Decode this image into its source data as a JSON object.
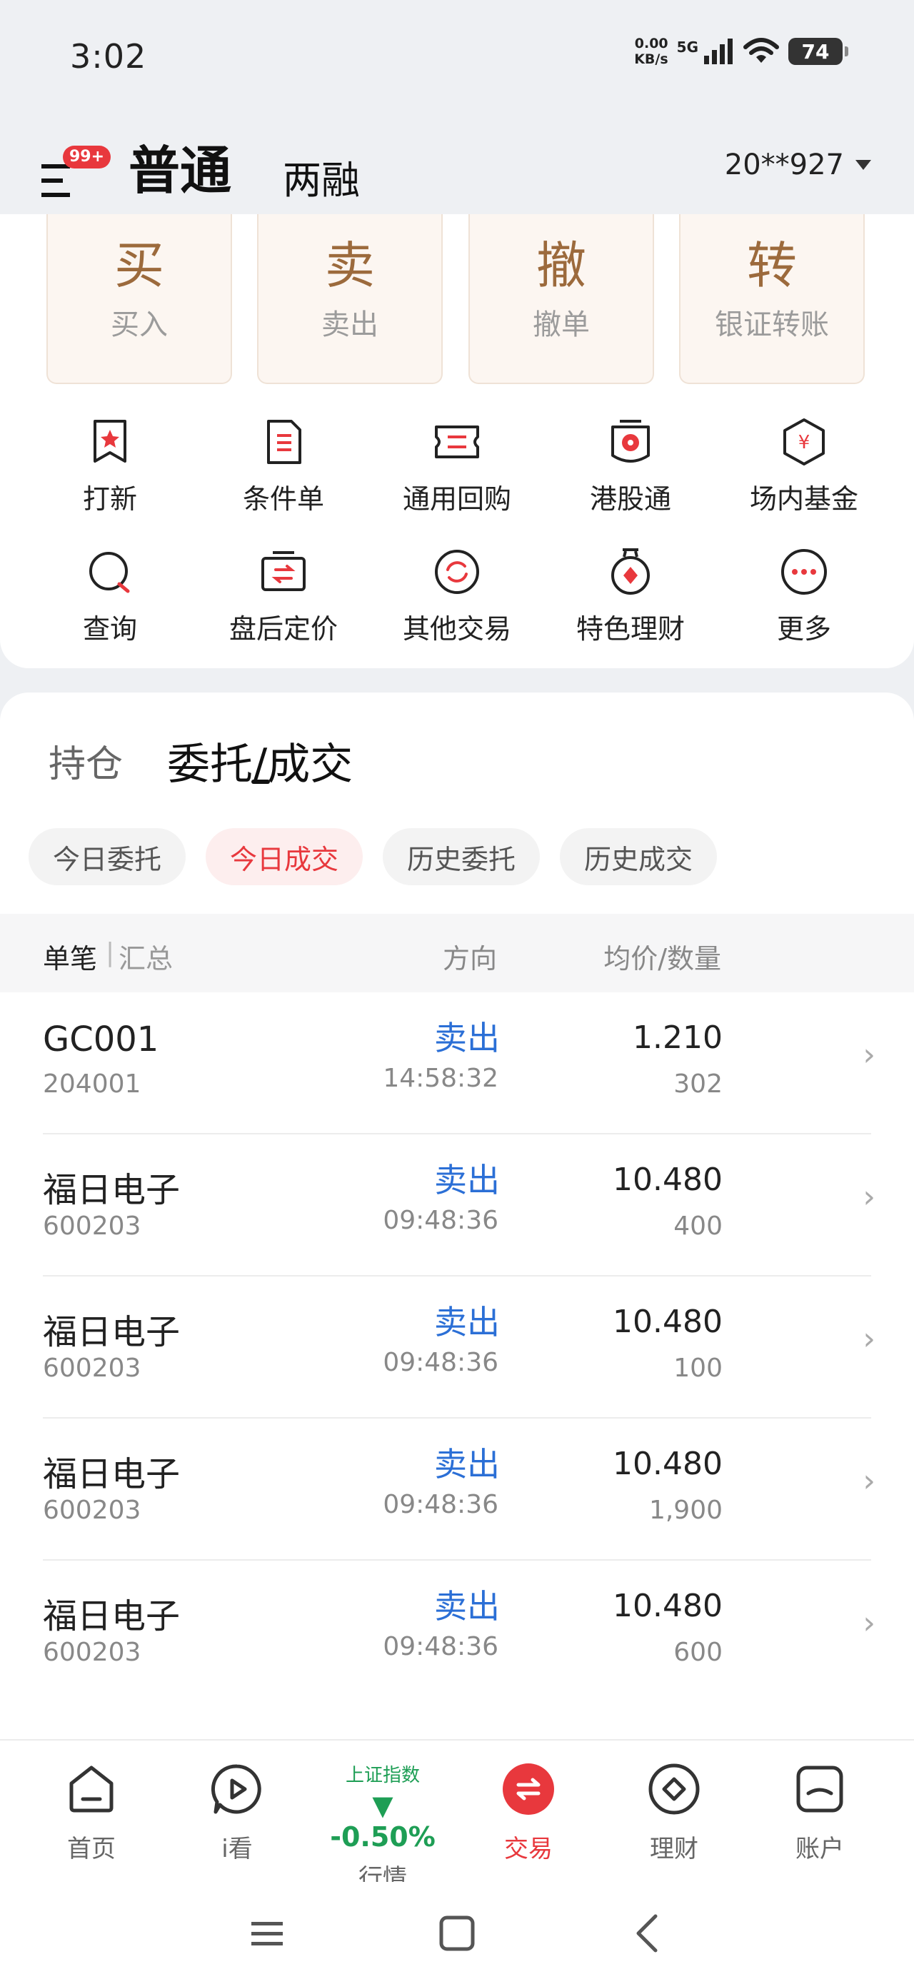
{
  "status_bar": {
    "time": "3:02",
    "net_speed_value": "0.00",
    "net_speed_unit": "KB/s",
    "network": "5G",
    "battery": "74"
  },
  "header": {
    "menu_badge": "99+",
    "tab_normal": "普通",
    "tab_margin": "两融",
    "account": "20**927"
  },
  "trade_buttons": [
    {
      "char": "买",
      "label": "买入"
    },
    {
      "char": "卖",
      "label": "卖出"
    },
    {
      "char": "撤",
      "label": "撤单"
    },
    {
      "char": "转",
      "label": "银证转账"
    }
  ],
  "functions": [
    {
      "label": "打新",
      "icon": "new-stock-icon"
    },
    {
      "label": "条件单",
      "icon": "conditional-order-icon"
    },
    {
      "label": "通用回购",
      "icon": "repo-icon"
    },
    {
      "label": "港股通",
      "icon": "hk-connect-icon"
    },
    {
      "label": "场内基金",
      "icon": "fund-icon"
    },
    {
      "label": "查询",
      "icon": "query-icon"
    },
    {
      "label": "盘后定价",
      "icon": "after-hours-icon"
    },
    {
      "label": "其他交易",
      "icon": "other-trade-icon"
    },
    {
      "label": "特色理财",
      "icon": "wealth-icon"
    },
    {
      "label": "更多",
      "icon": "more-icon"
    }
  ],
  "positions": {
    "tab_hold": "持仓",
    "tab_orders": "委托/成交",
    "chips": [
      "今日委托",
      "今日成交",
      "历史委托",
      "历史成交"
    ],
    "active_chip": "今日成交",
    "header": {
      "single": "单笔",
      "separator": "|",
      "summary": "汇总",
      "direction": "方向",
      "price_qty": "均价/数量"
    },
    "rows": [
      {
        "name": "GC001",
        "code": "204001",
        "direction": "卖出",
        "time": "14:58:32",
        "price": "1.210",
        "qty": "302"
      },
      {
        "name": "福日电子",
        "code": "600203",
        "direction": "卖出",
        "time": "09:48:36",
        "price": "10.480",
        "qty": "400"
      },
      {
        "name": "福日电子",
        "code": "600203",
        "direction": "卖出",
        "time": "09:48:36",
        "price": "10.480",
        "qty": "100"
      },
      {
        "name": "福日电子",
        "code": "600203",
        "direction": "卖出",
        "time": "09:48:36",
        "price": "10.480",
        "qty": "1,900"
      },
      {
        "name": "福日电子",
        "code": "600203",
        "direction": "卖出",
        "time": "09:48:36",
        "price": "10.480",
        "qty": "600"
      }
    ]
  },
  "bottom_nav": {
    "home": "首页",
    "watch": "i看",
    "index_name": "上证指数",
    "index_value": "▼ -0.50%",
    "market": "行情",
    "trade": "交易",
    "wealth": "理财",
    "account": "账户"
  },
  "colors": {
    "accent_red": "#e8383d",
    "sell_blue": "#2b6fd6",
    "down_green": "#1e9e55",
    "trade_brown": "#9c6a3c"
  }
}
